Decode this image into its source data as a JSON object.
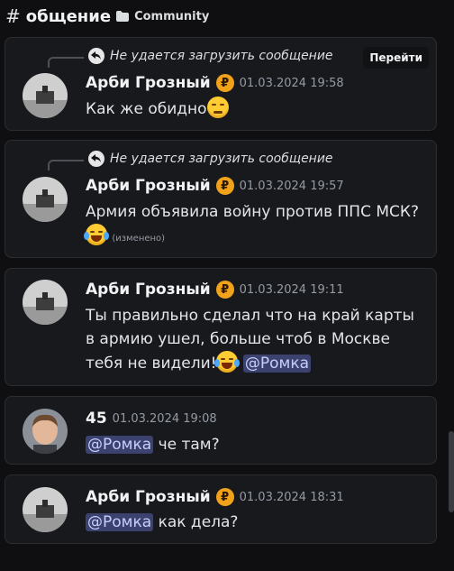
{
  "header": {
    "hash": "#",
    "channel": "общение",
    "category": "Community"
  },
  "reply": {
    "text": "Не удается загрузить сообщение",
    "jump_label": "Перейти"
  },
  "messages": [
    {
      "author": "Арби Грозный",
      "badge": "₽",
      "time": "01.03.2024 19:58",
      "text": "Как же обидно"
    },
    {
      "author": "Арби Грозный",
      "badge": "₽",
      "time": "01.03.2024 19:57",
      "text": "Армия объявила войну против ППС МСК?",
      "edited": "(изменено)"
    },
    {
      "author": "Арби Грозный",
      "badge": "₽",
      "time": "01.03.2024 19:11",
      "text": "Ты правильно сделал что на край карты в армию ушел, больше чтоб в Москве тебя не видели!",
      "mention": "@Ромка"
    },
    {
      "author": "45",
      "time": "01.03.2024 19:08",
      "mention": "@Ромка",
      "text": "че там?"
    },
    {
      "author": "Арби Грозный",
      "badge": "₽",
      "time": "01.03.2024 18:31",
      "mention": "@Ромка",
      "text": "как дела?"
    }
  ],
  "colors": {
    "background": "#0f0f11",
    "card": "#18191c",
    "mention_bg": "#3c4270",
    "badge": "#f0a21a"
  }
}
